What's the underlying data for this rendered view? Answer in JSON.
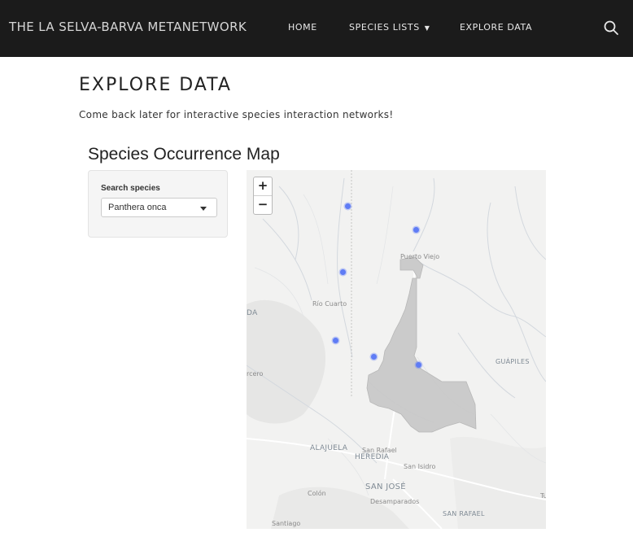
{
  "navbar": {
    "brand": "THE LA SELVA-BARVA METANETWORK",
    "items": [
      {
        "label": "HOME"
      },
      {
        "label": "SPECIES LISTS",
        "has_dropdown": true
      },
      {
        "label": "EXPLORE DATA"
      }
    ],
    "search_icon": "search-icon"
  },
  "page": {
    "title": "EXPLORE DATA",
    "intro": "Come back later for interactive species interaction networks!"
  },
  "app": {
    "section_title": "Species Occurrence Map",
    "search_label": "Search species",
    "selected_species": "Panthera onca"
  },
  "map": {
    "zoom_in": "+",
    "zoom_out": "−",
    "labels": [
      {
        "text": "Puerto Viejo"
      },
      {
        "text": "Río Cuarto"
      },
      {
        "text": "GUÁPILES"
      },
      {
        "text": "ALAJUELA"
      },
      {
        "text": "San Rafael"
      },
      {
        "text": "HEREDIA"
      },
      {
        "text": "San Isidro"
      },
      {
        "text": "SAN JOSÉ"
      },
      {
        "text": "Colón"
      },
      {
        "text": "Desamparados"
      },
      {
        "text": "SAN RAFAEL"
      },
      {
        "text": "Santiago"
      },
      {
        "text": "DA"
      },
      {
        "text": "rcero"
      },
      {
        "text": "Tu"
      }
    ],
    "occurrence_count": 6,
    "marker_color": "#5f7cf5",
    "region_fill": "#c9c9c9"
  }
}
